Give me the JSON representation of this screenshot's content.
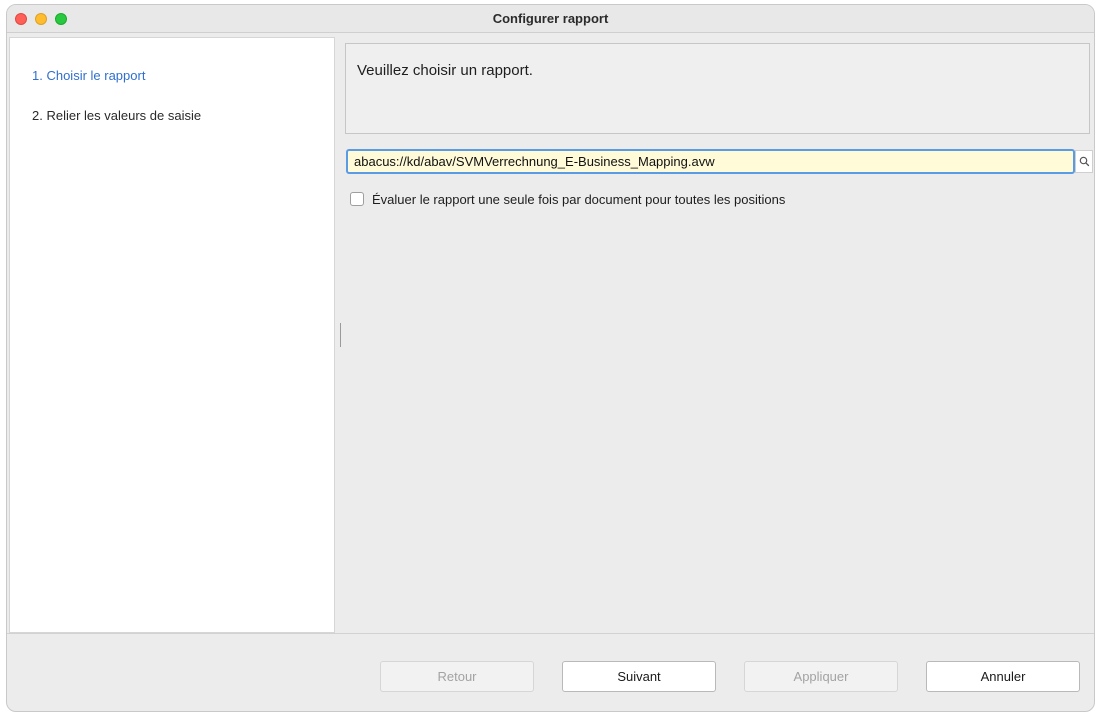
{
  "window": {
    "title": "Configurer rapport"
  },
  "sidebar": {
    "steps": [
      {
        "label": "1. Choisir le rapport",
        "active": true
      },
      {
        "label": "2. Relier les valeurs de saisie",
        "active": false
      }
    ]
  },
  "main": {
    "message": "Veuillez choisir un rapport.",
    "report_path": "abacus://kd/abav/SVMVerrechnung_E-Business_Mapping.avw",
    "evaluate_once_label": "Évaluer le rapport une seule fois par document pour toutes les positions",
    "evaluate_once_checked": false
  },
  "footer": {
    "back_label": "Retour",
    "next_label": "Suivant",
    "apply_label": "Appliquer",
    "cancel_label": "Annuler"
  },
  "colors": {
    "active_step": "#2f6fce",
    "field_background": "#fffbd9",
    "focus_ring": "#5a9be6"
  },
  "icons": {
    "search": "search-icon"
  }
}
